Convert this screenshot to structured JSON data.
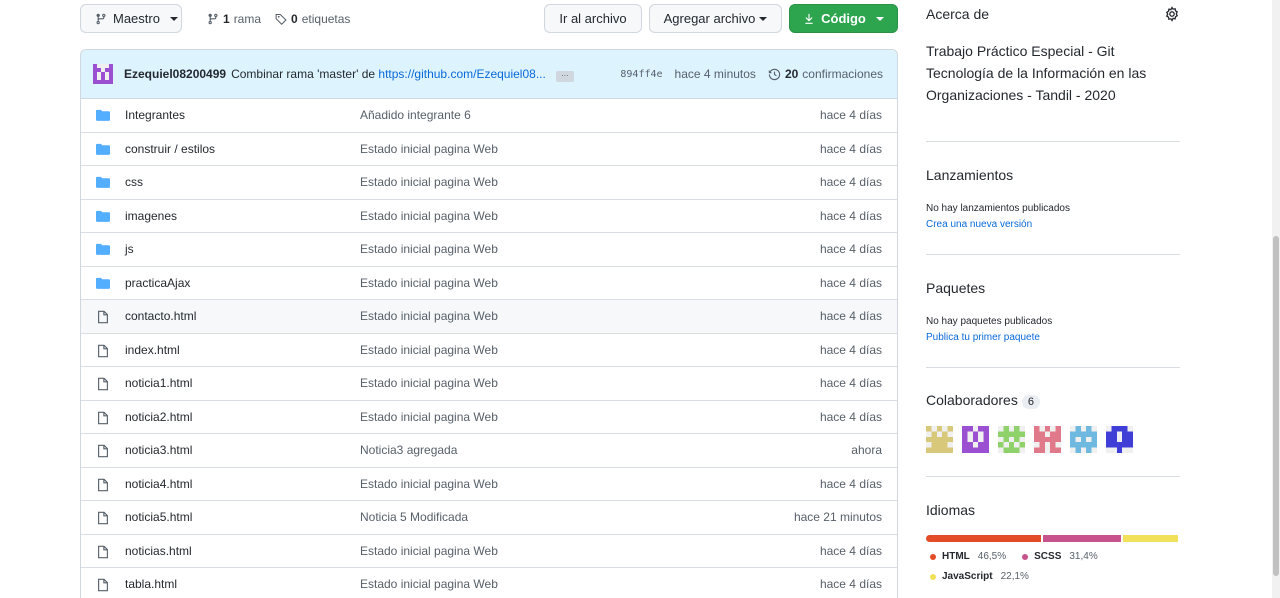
{
  "toolbar": {
    "branch_label": "Maestro",
    "branches_count": "1",
    "branches_label": "rama",
    "tags_count": "0",
    "tags_label": "etiquetas",
    "goto_file_label": "Ir al archivo",
    "add_file_label": "Agregar archivo",
    "code_label": "Código"
  },
  "commit": {
    "author": "Ezequiel08200499",
    "message": "Combinar rama 'master' de",
    "link": "https://github.com/Ezequiel08...",
    "sha": "894ff4e",
    "time": "hace 4 minutos",
    "count": "20",
    "count_label": "confirmaciones"
  },
  "files": [
    {
      "type": "dir",
      "name": "Integrantes",
      "msg": "Añadido integrante 6",
      "time": "hace 4 días"
    },
    {
      "type": "dir",
      "name": "construir / estilos",
      "msg": "Estado inicial pagina Web",
      "time": "hace 4 días"
    },
    {
      "type": "dir",
      "name": "css",
      "msg": "Estado inicial pagina Web",
      "time": "hace 4 días"
    },
    {
      "type": "dir",
      "name": "imagenes",
      "msg": "Estado inicial pagina Web",
      "time": "hace 4 días"
    },
    {
      "type": "dir",
      "name": "js",
      "msg": "Estado inicial pagina Web",
      "time": "hace 4 días"
    },
    {
      "type": "dir",
      "name": "practicaAjax",
      "msg": "Estado inicial pagina Web",
      "time": "hace 4 días"
    },
    {
      "type": "file",
      "name": "contacto.html",
      "msg": "Estado inicial pagina Web",
      "time": "hace 4 días"
    },
    {
      "type": "file",
      "name": "index.html",
      "msg": "Estado inicial pagina Web",
      "time": "hace 4 días"
    },
    {
      "type": "file",
      "name": "noticia1.html",
      "msg": "Estado inicial pagina Web",
      "time": "hace 4 días"
    },
    {
      "type": "file",
      "name": "noticia2.html",
      "msg": "Estado inicial pagina Web",
      "time": "hace 4 días"
    },
    {
      "type": "file",
      "name": "noticia3.html",
      "msg": "Noticia3 agregada",
      "time": "ahora"
    },
    {
      "type": "file",
      "name": "noticia4.html",
      "msg": "Estado inicial pagina Web",
      "time": "hace 4 días"
    },
    {
      "type": "file",
      "name": "noticia5.html",
      "msg": "Noticia 5 Modificada",
      "time": "hace 21 minutos"
    },
    {
      "type": "file",
      "name": "noticias.html",
      "msg": "Estado inicial pagina Web",
      "time": "hace 4 días"
    },
    {
      "type": "file",
      "name": "tabla.html",
      "msg": "Estado inicial pagina Web",
      "time": "hace 4 días"
    }
  ],
  "sidebar": {
    "about_title": "Acerca de",
    "about_text": "Trabajo Práctico Especial - Git Tecnología de la Información en las Organizaciones - Tandil - 2020",
    "releases_title": "Lanzamientos",
    "releases_empty": "No hay lanzamientos publicados",
    "releases_link": "Crea una nueva versión",
    "packages_title": "Paquetes",
    "packages_empty": "No hay paquetes publicados",
    "packages_link": "Publica tu primer paquete",
    "contributors_title": "Colaboradores",
    "contributors_count": "6",
    "contributors": [
      {
        "name": "avatar-1",
        "color": "#d8c97a"
      },
      {
        "name": "avatar-2",
        "color": "#9b4fd1"
      },
      {
        "name": "avatar-3",
        "color": "#8fd16b"
      },
      {
        "name": "avatar-4",
        "color": "#e07a8a"
      },
      {
        "name": "avatar-5",
        "color": "#6fb9e0"
      },
      {
        "name": "avatar-6",
        "color": "#3f3fd8"
      }
    ],
    "languages_title": "Idiomas",
    "languages": [
      {
        "name": "HTML",
        "pct": "46,5%",
        "value": 46.5,
        "color": "#e34c26"
      },
      {
        "name": "SCSS",
        "pct": "31,4%",
        "value": 31.4,
        "color": "#c6538c"
      },
      {
        "name": "JavaScript",
        "pct": "22,1%",
        "value": 22.1,
        "color": "#f1e05a"
      }
    ]
  },
  "colors": {
    "accent_green": "#2da44e",
    "link_blue": "#0969da",
    "folder_blue": "#54aeff",
    "commit_bar_bg": "#ddf4ff"
  }
}
